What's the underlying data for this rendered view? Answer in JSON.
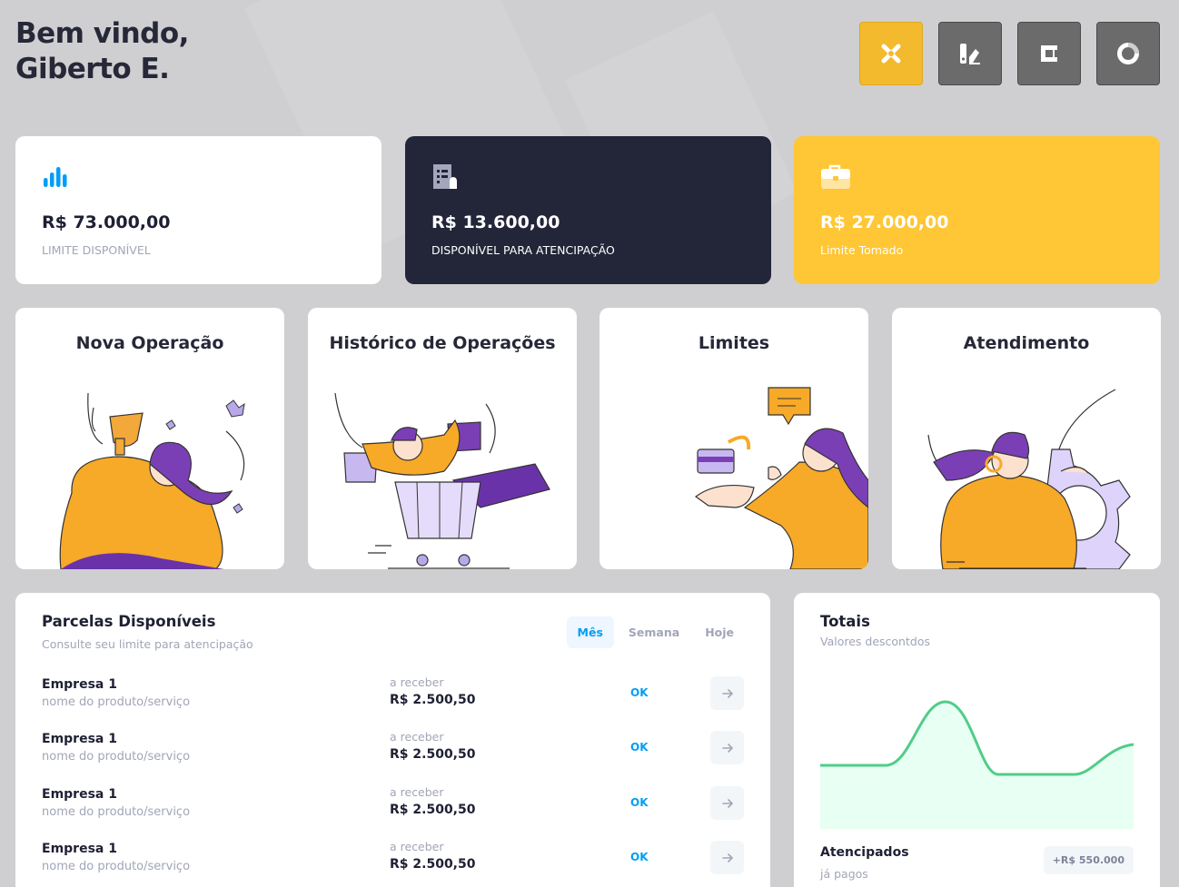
{
  "header": {
    "greeting_line1": "Bem vindo,",
    "greeting_line2": "Giberto E.",
    "actions": [
      {
        "name": "close-icon"
      },
      {
        "name": "chart-edit-icon"
      },
      {
        "name": "layers-icon"
      },
      {
        "name": "donut-icon"
      }
    ]
  },
  "stats": [
    {
      "amount": "R$ 73.000,00",
      "label": "LIMITE DISPONÍVEL",
      "icon": "bar-chart-icon"
    },
    {
      "amount": "R$ 13.600,00",
      "label": "DISPONÍVEL PARA ATENCIPAÇÃO",
      "icon": "receipt-icon"
    },
    {
      "amount": "R$ 27.000,00",
      "label": "Limite Tomado",
      "icon": "briefcase-icon"
    }
  ],
  "features": [
    {
      "title": "Nova Operação"
    },
    {
      "title": "Histórico de Operações"
    },
    {
      "title": "Limites"
    },
    {
      "title": "Atendimento"
    }
  ],
  "parcelas": {
    "title": "Parcelas Disponíveis",
    "subtitle": "Consulte seu limite para atencipação",
    "tabs": [
      "Mês",
      "Semana",
      "Hoje"
    ],
    "active_tab": "Mês",
    "rows": [
      {
        "company": "Empresa 1",
        "product": "nome do produto/serviço",
        "receive_label": "a receber",
        "value": "R$ 2.500,50",
        "status": "OK"
      },
      {
        "company": "Empresa 1",
        "product": "nome do produto/serviço",
        "receive_label": "a receber",
        "value": "R$ 2.500,50",
        "status": "OK"
      },
      {
        "company": "Empresa 1",
        "product": "nome do produto/serviço",
        "receive_label": "a receber",
        "value": "R$ 2.500,50",
        "status": "OK"
      },
      {
        "company": "Empresa 1",
        "product": "nome do produto/serviço",
        "receive_label": "a receber",
        "value": "R$ 2.500,50",
        "status": "OK"
      }
    ]
  },
  "totais": {
    "title": "Totais",
    "subtitle": "Valores descontdos",
    "footer_title": "Atencipados",
    "footer_sub": "já pagos",
    "badge": "+R$ 550.000"
  },
  "colors": {
    "accent_yellow": "#ffc635",
    "dark_card": "#232539",
    "primary_blue": "#009ef7",
    "chart_green": "#50cd89",
    "chart_fill": "#e8fff3"
  }
}
